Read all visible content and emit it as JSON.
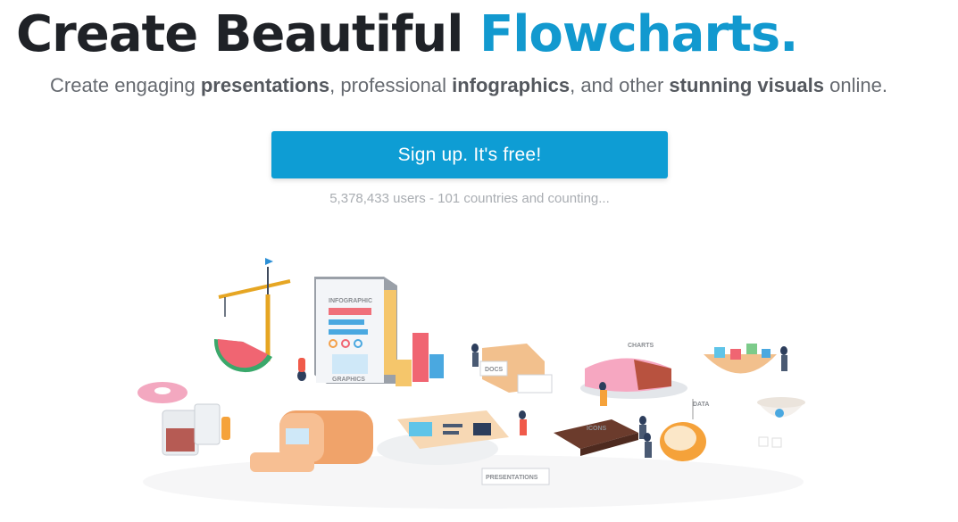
{
  "hero": {
    "title_main": "Create Beautiful ",
    "title_accent": "Flowcharts.",
    "subtitle": {
      "p1": "Create engaging ",
      "b1": "presentations",
      "p2": ", professional ",
      "b2": "infographics",
      "p3": ", and other ",
      "b3": "stunning visuals",
      "p4": " online."
    },
    "cta_label": "Sign up. It's free!",
    "user_count": "5,378,433 users - 101 countries and counting..."
  },
  "illustration": {
    "labels": {
      "infographic": "INFOGRAPHIC",
      "graphics": "GRAPHICS",
      "docs": "DOCS",
      "charts": "CHARTS",
      "icons": "ICONS",
      "data": "DATA",
      "presentations": "PRESENTATIONS"
    }
  },
  "colors": {
    "accent": "#1299cf",
    "button": "#0e9dd4",
    "heading": "#1f2227",
    "subtitle": "#666a70",
    "muted": "#a9adb2"
  }
}
